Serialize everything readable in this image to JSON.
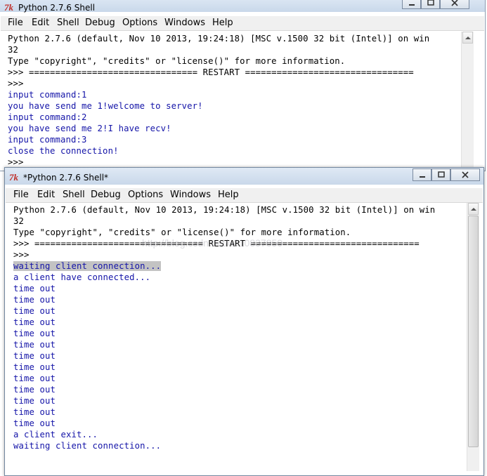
{
  "window1": {
    "title": "Python 2.7.6 Shell",
    "menu": [
      "File",
      "Edit",
      "Shell",
      "Debug",
      "Options",
      "Windows",
      "Help"
    ],
    "lines": [
      {
        "text": "Python 2.7.6 (default, Nov 10 2013, 19:24:18) [MSC v.1500 32 bit (Intel)] on win",
        "color": "black"
      },
      {
        "text": "32",
        "color": "black"
      },
      {
        "text": "Type \"copyright\", \"credits\" or \"license()\" for more information.",
        "color": "black"
      },
      {
        "text": ">>> ================================ RESTART ================================",
        "color": "black"
      },
      {
        "text": ">>>",
        "color": "black"
      },
      {
        "text": "input command:1",
        "color": "blue"
      },
      {
        "text": "you have send me 1!welcome to server!",
        "color": "blue"
      },
      {
        "text": "input command:2",
        "color": "blue"
      },
      {
        "text": "you have send me 2!I have recv!",
        "color": "blue"
      },
      {
        "text": "input command:3",
        "color": "blue"
      },
      {
        "text": "close the connection!",
        "color": "blue"
      },
      {
        "text": ">>>",
        "color": "black"
      }
    ]
  },
  "window2": {
    "title": "*Python 2.7.6 Shell*",
    "menu": [
      "File",
      "Edit",
      "Shell",
      "Debug",
      "Options",
      "Windows",
      "Help"
    ],
    "lines": [
      {
        "text": "Python 2.7.6 (default, Nov 10 2013, 19:24:18) [MSC v.1500 32 bit (Intel)] on win",
        "color": "black"
      },
      {
        "text": "32",
        "color": "black"
      },
      {
        "text": "Type \"copyright\", \"credits\" or \"license()\" for more information.",
        "color": "black"
      },
      {
        "text": ">>> ================================ RESTART ================================",
        "color": "black"
      },
      {
        "text": ">>>",
        "color": "black"
      },
      {
        "text": "waiting client connection...",
        "color": "blue",
        "selected": true
      },
      {
        "text": "a client have connected...",
        "color": "blue"
      },
      {
        "text": "time out",
        "color": "blue"
      },
      {
        "text": "time out",
        "color": "blue"
      },
      {
        "text": "time out",
        "color": "blue"
      },
      {
        "text": "time out",
        "color": "blue"
      },
      {
        "text": "time out",
        "color": "blue"
      },
      {
        "text": "time out",
        "color": "blue"
      },
      {
        "text": "time out",
        "color": "blue"
      },
      {
        "text": "time out",
        "color": "blue"
      },
      {
        "text": "time out",
        "color": "blue"
      },
      {
        "text": "time out",
        "color": "blue"
      },
      {
        "text": "time out",
        "color": "blue"
      },
      {
        "text": "time out",
        "color": "blue"
      },
      {
        "text": "time out",
        "color": "blue"
      },
      {
        "text": "a client exit...",
        "color": "blue"
      },
      {
        "text": "waiting client connection...",
        "color": "blue"
      }
    ]
  },
  "watermark": "http://blog.csdn.net/u010837850",
  "colors": {
    "black": "#000000",
    "blue": "#1414a8",
    "selection": "#c3c3c3"
  }
}
